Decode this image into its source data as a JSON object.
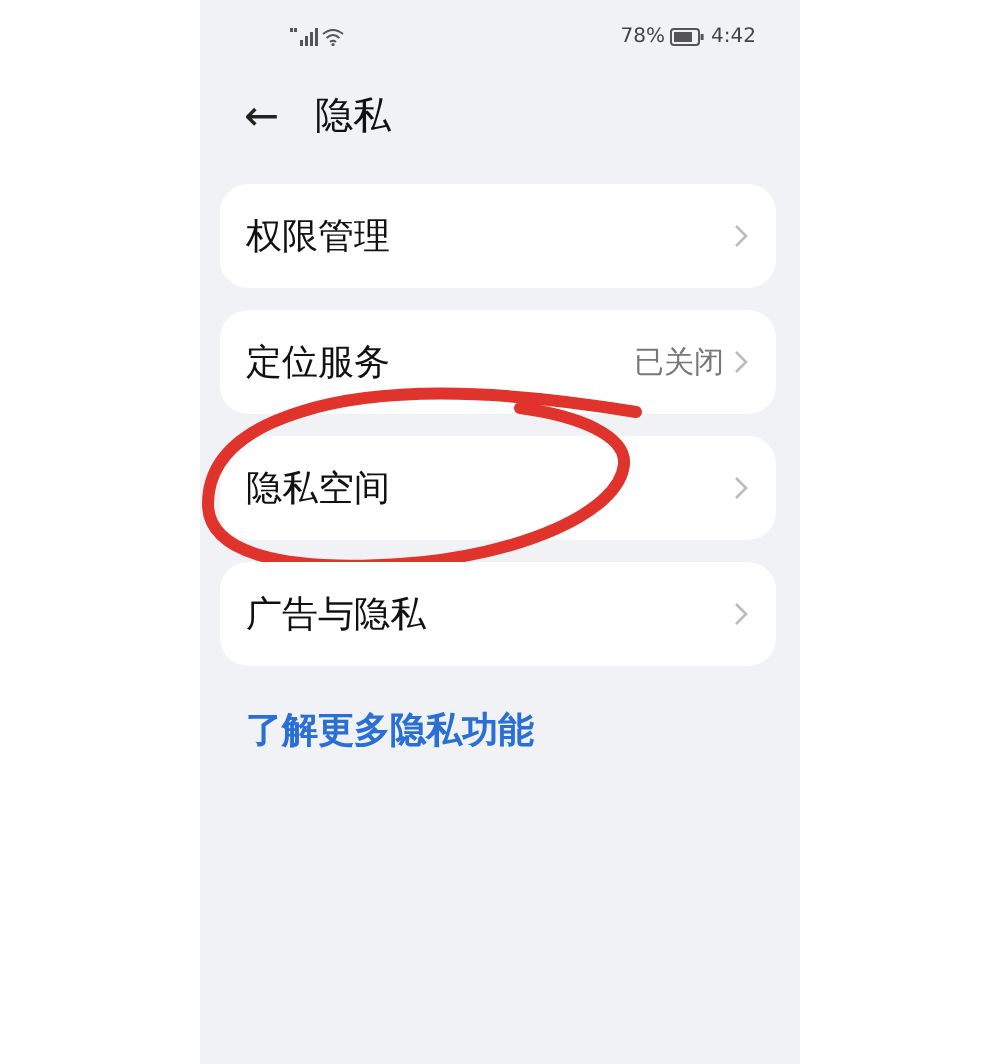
{
  "status_bar": {
    "battery": "78%",
    "time": "4:42"
  },
  "header": {
    "back_icon": "←",
    "title": "隐私"
  },
  "items": [
    {
      "label": "权限管理",
      "highlight": false
    },
    {
      "label": "定位服务",
      "value": "已关闭",
      "highlight": false
    },
    {
      "label": "隐私空间",
      "highlight": true
    },
    {
      "label": "广告与隐私",
      "highlight": false
    }
  ],
  "link": "了解更多隐私功能"
}
